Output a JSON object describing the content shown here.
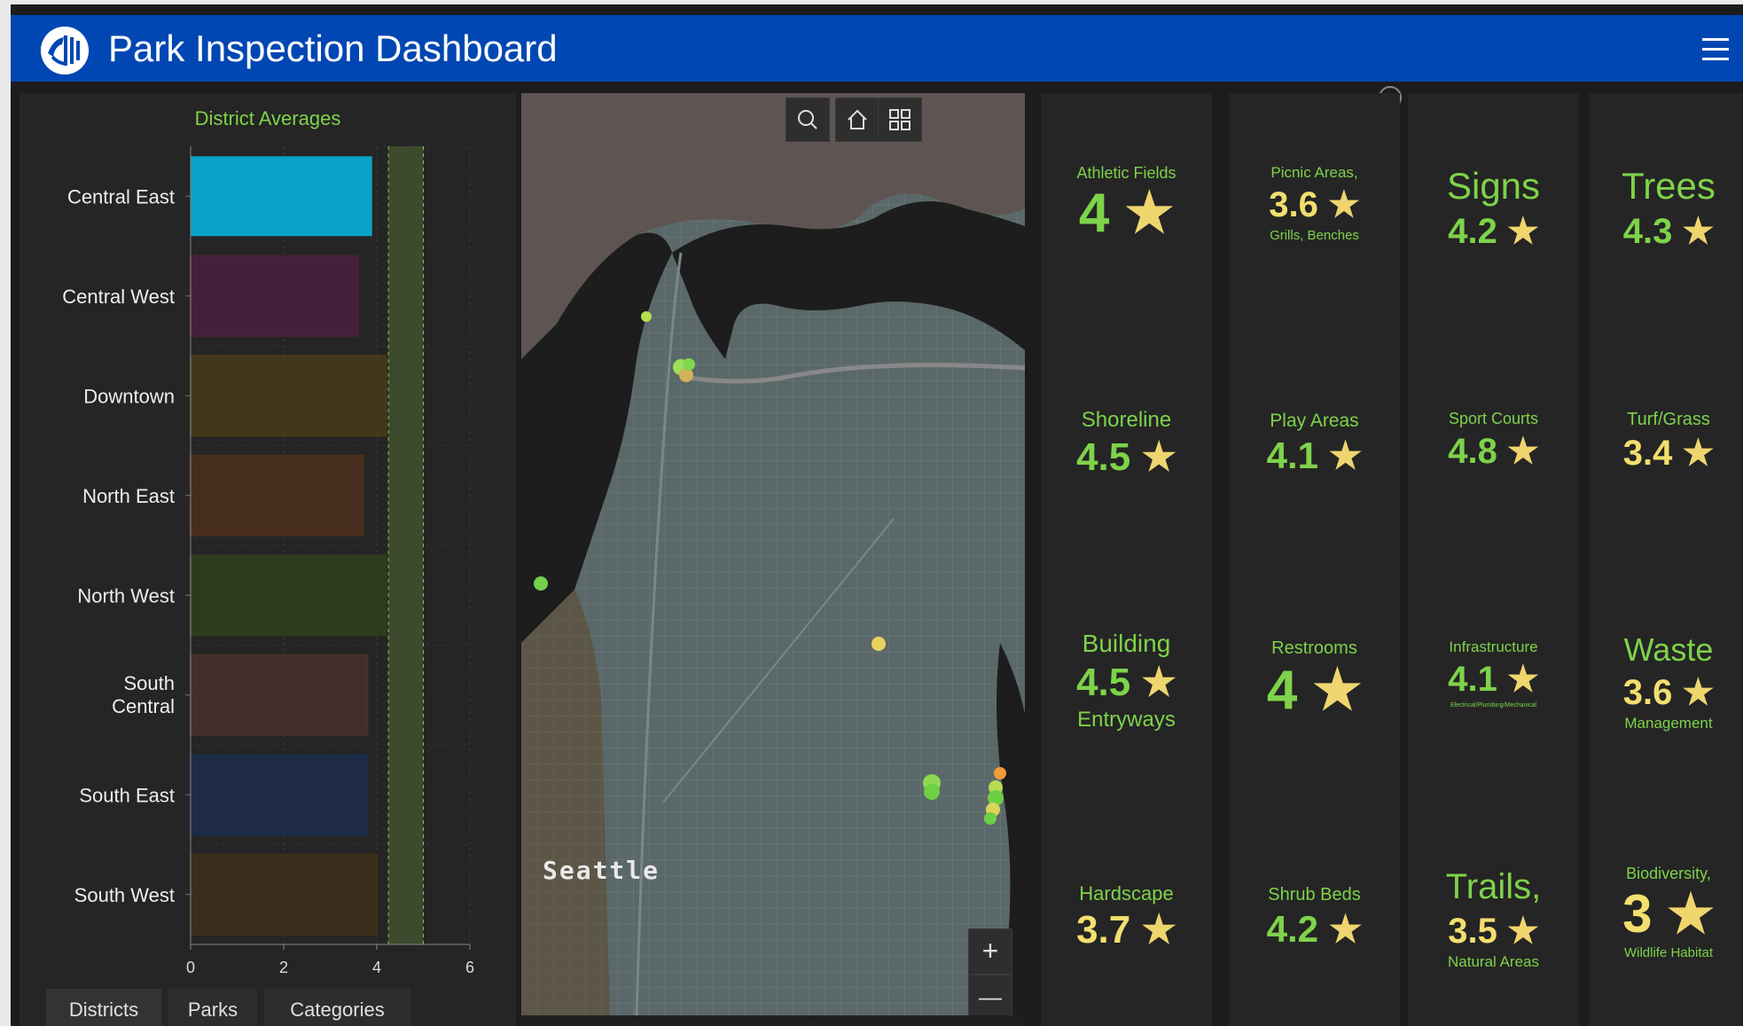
{
  "app": {
    "title": "Park Inspection Dashboard"
  },
  "chart": {
    "title": "District Averages",
    "tabs": [
      "Districts",
      "Parks",
      "Categories"
    ]
  },
  "chart_data": {
    "type": "bar",
    "orientation": "horizontal",
    "title": "District Averages",
    "categories": [
      "Central East",
      "Central West",
      "Downtown",
      "North East",
      "North West",
      "South Central",
      "South East",
      "South West"
    ],
    "values": [
      3.9,
      3.6,
      4.2,
      3.7,
      4.2,
      3.8,
      3.8,
      4.0
    ],
    "xlim": [
      0,
      6
    ],
    "xticks": [
      "0",
      "2",
      "4",
      "6"
    ],
    "band": [
      4.25,
      5.0
    ],
    "colors": [
      "#0aa2c8",
      "#4a2040",
      "#4a3a1a",
      "#4e2f1c",
      "#2e3f1c",
      "#4a302a",
      "#1c2d4a",
      "#3f301c"
    ],
    "highlighted": "Central East",
    "grid": true
  },
  "map": {
    "place_label": "Seattle",
    "search_icon": "search-icon",
    "home_icon": "home-icon",
    "basemap_icon": "basemap-gallery-icon",
    "zoom_in": "+",
    "zoom_out": "—"
  },
  "categories": [
    {
      "label": "Athletic Fields",
      "value": "4",
      "sub": ""
    },
    {
      "label": "Shoreline",
      "value": "4.5",
      "sub": ""
    },
    {
      "label": "Building",
      "value": "4.5",
      "sub": "Entryways"
    },
    {
      "label": "Hardscape",
      "value": "3.7",
      "sub": ""
    },
    {
      "label": "Picnic Areas,",
      "value": "3.6",
      "sub": "Grills, Benches"
    },
    {
      "label": "Play Areas",
      "value": "4.1",
      "sub": ""
    },
    {
      "label": "Restrooms",
      "value": "4",
      "sub": ""
    },
    {
      "label": "Shrub Beds",
      "value": "4.2",
      "sub": ""
    },
    {
      "label": "Signs",
      "value": "4.2",
      "sub": ""
    },
    {
      "label": "Sport Courts",
      "value": "4.8",
      "sub": ""
    },
    {
      "label": "Infrastructure",
      "value": "4.1",
      "sub": "Electrical/Plumbing/Mechanical"
    },
    {
      "label": "Trails,",
      "value": "3.5",
      "sub": "Natural Areas"
    },
    {
      "label": "Trees",
      "value": "4.3",
      "sub": ""
    },
    {
      "label": "Turf/Grass",
      "value": "3.4",
      "sub": ""
    },
    {
      "label": "Waste",
      "value": "3.6",
      "sub": "Management"
    },
    {
      "label": "Biodiversity,",
      "value": "3",
      "sub": "Wildlife Habitat"
    }
  ],
  "star_glyph": "★",
  "colors": {
    "header": "#0047b3",
    "accent_green": "#7ed34a",
    "accent_yellow": "#f2df6e",
    "star": "#efd56e"
  }
}
